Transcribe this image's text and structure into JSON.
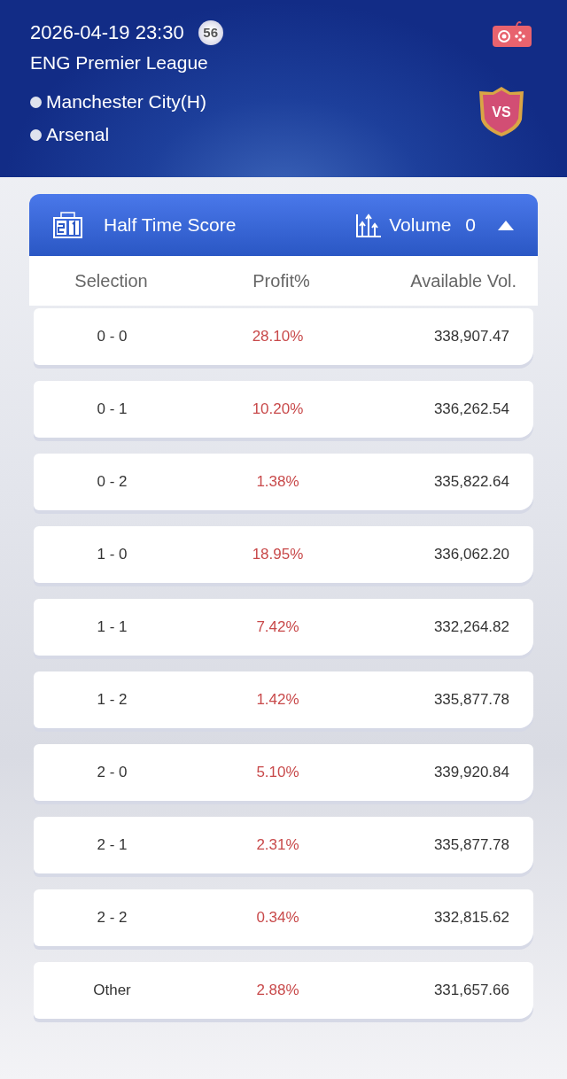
{
  "match": {
    "datetime": "2026-04-19 23:30",
    "badge": "56",
    "league": "ENG Premier League",
    "teams": [
      {
        "name": "Manchester City(H)"
      },
      {
        "name": "Arsenal"
      }
    ],
    "vs": "VS"
  },
  "market": {
    "title": "Half Time Score",
    "volume_label": "Volume",
    "volume": "0",
    "expanded": true
  },
  "table": {
    "columns": [
      "Selection",
      "Profit%",
      "Available Vol."
    ],
    "rows": [
      {
        "selection": "0 - 0",
        "profit": "28.10%",
        "available": "338,907.47"
      },
      {
        "selection": "0 - 1",
        "profit": "10.20%",
        "available": "336,262.54"
      },
      {
        "selection": "0 - 2",
        "profit": "1.38%",
        "available": "335,822.64"
      },
      {
        "selection": "1 - 0",
        "profit": "18.95%",
        "available": "336,062.20"
      },
      {
        "selection": "1 - 1",
        "profit": "7.42%",
        "available": "332,264.82"
      },
      {
        "selection": "1 - 2",
        "profit": "1.42%",
        "available": "335,877.78"
      },
      {
        "selection": "2 - 0",
        "profit": "5.10%",
        "available": "339,920.84"
      },
      {
        "selection": "2 - 1",
        "profit": "2.31%",
        "available": "335,877.78"
      },
      {
        "selection": "2 - 2",
        "profit": "0.34%",
        "available": "332,815.62"
      },
      {
        "selection": "Other",
        "profit": "2.88%",
        "available": "331,657.66"
      }
    ]
  }
}
